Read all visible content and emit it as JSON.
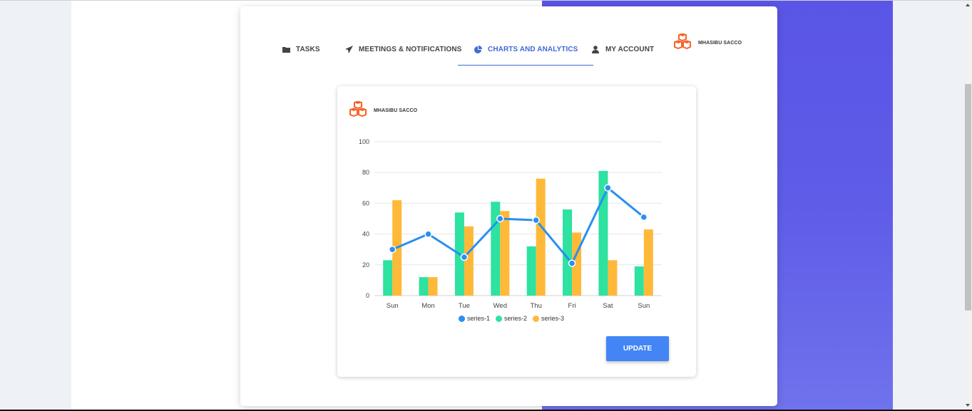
{
  "nav": {
    "tabs": [
      {
        "label": "TASKS",
        "icon": "folder-icon"
      },
      {
        "label": "MEETINGS & NOTIFICATIONS",
        "icon": "paper-plane-icon"
      },
      {
        "label": "CHARTS AND ANALYTICS",
        "icon": "pie-chart-icon",
        "active": true
      },
      {
        "label": "MY ACCOUNT",
        "icon": "user-icon"
      }
    ],
    "brand": "MHASIBU SACCO"
  },
  "card": {
    "brand": "MHASIBU SACCO",
    "update_label": "UPDATE"
  },
  "colors": {
    "accent": "#3f6ad8",
    "series1": "#2a8ff0",
    "series2": "#2ee2a0",
    "series3": "#ffb938",
    "button": "#4385f5",
    "logo": "#f6632a"
  },
  "chart_data": {
    "type": "bar",
    "categories": [
      "Sun",
      "Mon",
      "Tue",
      "Wed",
      "Thu",
      "Fri",
      "Sat",
      "Sun"
    ],
    "ylim": [
      0,
      100
    ],
    "yticks": [
      0,
      20,
      40,
      60,
      80,
      100
    ],
    "grid": true,
    "legend_position": "bottom",
    "series": [
      {
        "name": "series-1",
        "type": "line",
        "values": [
          30,
          40,
          25,
          50,
          49,
          21,
          70,
          51
        ]
      },
      {
        "name": "series-2",
        "type": "bar",
        "values": [
          23,
          12,
          54,
          61,
          32,
          56,
          81,
          19
        ]
      },
      {
        "name": "series-3",
        "type": "bar",
        "values": [
          62,
          12,
          45,
          55,
          76,
          41,
          23,
          43
        ]
      }
    ]
  }
}
